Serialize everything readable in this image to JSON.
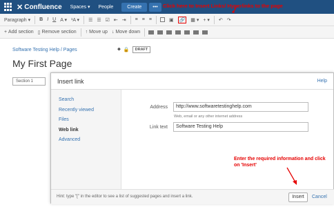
{
  "topnav": {
    "logo_text": "Confluence",
    "spaces_label": "Spaces ▾",
    "people_label": "People",
    "create_label": "Create",
    "more_label": "•••"
  },
  "annotations": {
    "top": "Click here to Insert Links/ Hyperlinks  to the page",
    "bottom": "Enter the required information and click on 'Insert'"
  },
  "toolbar": {
    "paragraph_label": "Paragraph ▾",
    "add_section_label": "Add section",
    "remove_section_label": "Remove section",
    "move_up_label": "Move up",
    "move_down_label": "Move down"
  },
  "page": {
    "breadcrumb": "Software Testing Help / Pages",
    "draft_label": "DRAFT",
    "title": "My First Page",
    "section_label": "Section 1"
  },
  "dialog": {
    "title": "Insert link",
    "help_label": "Help",
    "sidebar_items": [
      {
        "label": "Search",
        "active": false
      },
      {
        "label": "Recently viewed",
        "active": false
      },
      {
        "label": "Files",
        "active": false
      },
      {
        "label": "Web link",
        "active": true
      },
      {
        "label": "Advanced",
        "active": false
      }
    ],
    "address_label": "Address",
    "address_value": "http://www.softwaretestinghelp.com",
    "address_hint": "Web, email or any other internet address",
    "linktext_label": "Link text",
    "linktext_value": "Software Testing Help",
    "footer_hint": "Hint: type \"[\" in the editor to see a list of suggested pages and insert a link.",
    "insert_label": "Insert",
    "cancel_label": "Cancel"
  },
  "colors": {
    "nav_bg": "#205081",
    "create_bg": "#3572b0",
    "annotation": "#e60000",
    "link": "#3572b0"
  }
}
